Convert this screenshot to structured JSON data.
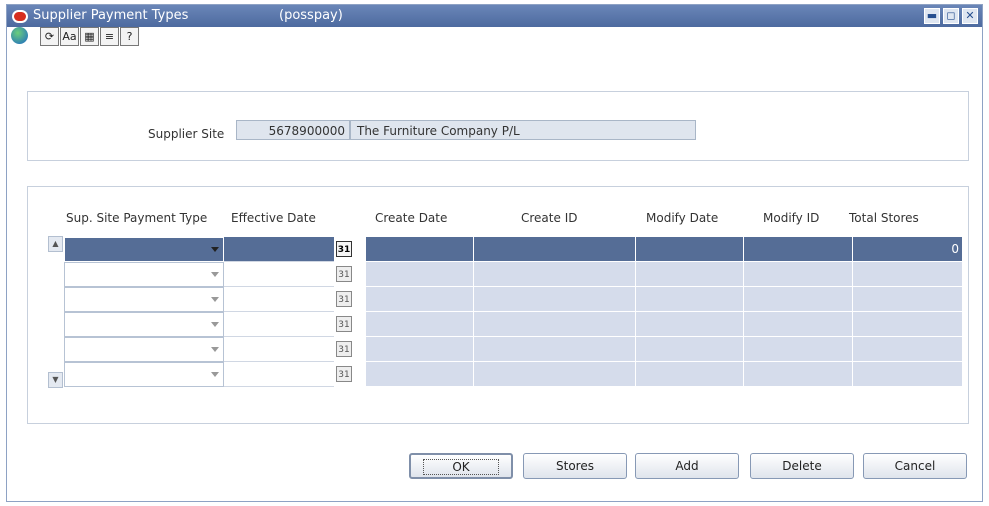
{
  "window": {
    "title": "Supplier Payment Types",
    "form_id": "(posspay)",
    "controls": [
      "▬",
      "◻",
      "✕"
    ]
  },
  "toolbar": [
    {
      "icon": "globe-icon",
      "glyph": ""
    },
    {
      "icon": "navigate-icon",
      "glyph": "⟳"
    },
    {
      "icon": "translate-icon",
      "glyph": "Aa"
    },
    {
      "icon": "calendar-icon",
      "glyph": "▦"
    },
    {
      "icon": "notes-icon",
      "glyph": "≡"
    },
    {
      "icon": "help-icon",
      "glyph": "?"
    }
  ],
  "header": {
    "supplier_site_label": "Supplier Site",
    "supplier_site_id": "5678900000",
    "supplier_site_name": "The Furniture Company P/L"
  },
  "grid": {
    "columns": [
      "Sup. Site Payment Type",
      "Effective Date",
      "Create Date",
      "Create ID",
      "Modify Date",
      "Modify ID",
      "Total Stores"
    ],
    "rows": [
      {
        "payment_type": "",
        "effective_date": "",
        "create_date": "",
        "create_id": "",
        "modify_date": "",
        "modify_id": "",
        "total_stores": "0",
        "selected": true
      },
      {
        "payment_type": "",
        "effective_date": "",
        "create_date": "",
        "create_id": "",
        "modify_date": "",
        "modify_id": "",
        "total_stores": ""
      },
      {
        "payment_type": "",
        "effective_date": "",
        "create_date": "",
        "create_id": "",
        "modify_date": "",
        "modify_id": "",
        "total_stores": ""
      },
      {
        "payment_type": "",
        "effective_date": "",
        "create_date": "",
        "create_id": "",
        "modify_date": "",
        "modify_id": "",
        "total_stores": ""
      },
      {
        "payment_type": "",
        "effective_date": "",
        "create_date": "",
        "create_id": "",
        "modify_date": "",
        "modify_id": "",
        "total_stores": ""
      },
      {
        "payment_type": "",
        "effective_date": "",
        "create_date": "",
        "create_id": "",
        "modify_date": "",
        "modify_id": "",
        "total_stores": ""
      }
    ],
    "calendar_glyph": "31"
  },
  "buttons": {
    "ok": "OK",
    "stores": "Stores",
    "add": "Add",
    "delete": "Delete",
    "cancel": "Cancel"
  }
}
